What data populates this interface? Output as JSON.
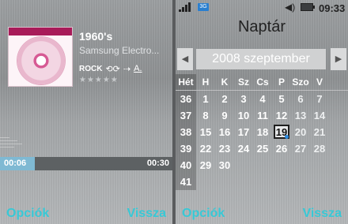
{
  "player": {
    "title": "1960's",
    "artist": "Samsung Electro...",
    "genre": "ROCK",
    "elapsed": "00:06",
    "duration": "00:30",
    "progress_fraction": 0.2,
    "rating_stars": "★★★★★",
    "softkeys": {
      "left": "Opciók",
      "right": "Vissza"
    }
  },
  "status_bar": {
    "time": "09:33",
    "network_badge": "3G",
    "icons": [
      "signal-icon",
      "network-icon",
      "volume-icon",
      "battery-icon"
    ]
  },
  "calendar": {
    "title": "Naptár",
    "month": "2008 szeptember",
    "headers": [
      "Hét",
      "H",
      "K",
      "Sz",
      "Cs",
      "P",
      "Szo",
      "V"
    ],
    "weeks": [
      {
        "wk": "36",
        "days": [
          "1",
          "2",
          "3",
          "4",
          "5",
          "6",
          "7"
        ]
      },
      {
        "wk": "37",
        "days": [
          "8",
          "9",
          "10",
          "11",
          "12",
          "13",
          "14"
        ]
      },
      {
        "wk": "38",
        "days": [
          "15",
          "16",
          "17",
          "18",
          "19",
          "20",
          "21"
        ]
      },
      {
        "wk": "39",
        "days": [
          "22",
          "23",
          "24",
          "25",
          "26",
          "27",
          "28"
        ]
      },
      {
        "wk": "40",
        "days": [
          "29",
          "30",
          "",
          "",
          "",
          "",
          ""
        ]
      },
      {
        "wk": "41",
        "days": [
          "",
          "",
          "",
          "",
          "",
          "",
          ""
        ]
      }
    ],
    "selected_day": "19",
    "softkeys": {
      "left": "Opciók",
      "right": "Vissza"
    }
  },
  "colors": {
    "softkey": "#37c9d6",
    "progress": "#7fb9d3",
    "album_accent": "#a81b59"
  }
}
